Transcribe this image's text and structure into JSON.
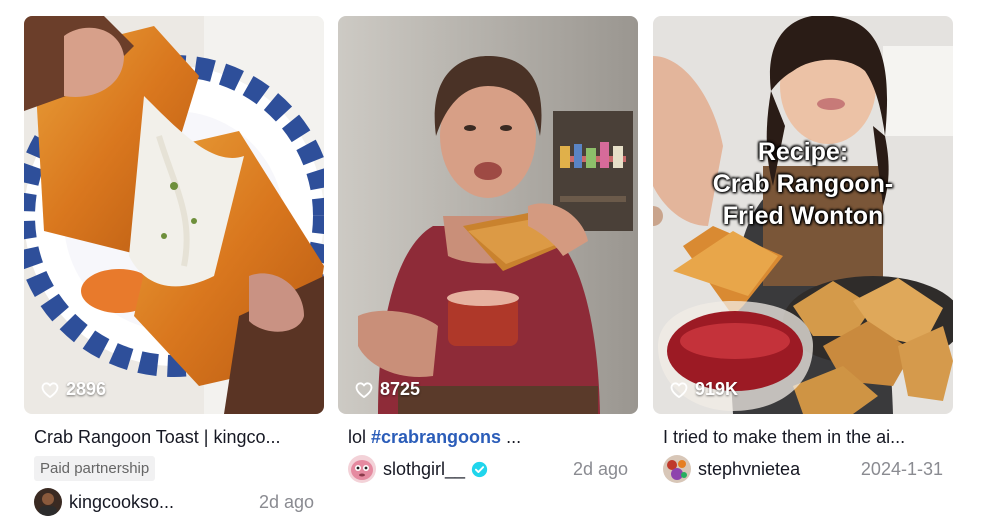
{
  "cards": [
    {
      "likes": "2896",
      "description": "Crab Rangoon Toast | kingco...",
      "badge": "Paid partnership",
      "username": "kingcookso...",
      "date": "2d ago",
      "verified": false
    },
    {
      "likes": "8725",
      "description_prefix": "lol ",
      "hashtag": "#crabrangoons",
      "description_suffix": " ...",
      "username": "slothgirl__",
      "date": "2d ago",
      "verified": true
    },
    {
      "likes": "919K",
      "overlay_text": [
        "Recipe:",
        "Crab Rangoon-",
        "Fried Wonton"
      ],
      "description": "I tried to make them in the ai...",
      "username": "stephvnietea",
      "date": "2024-1-31",
      "verified": false
    }
  ],
  "icons": {
    "like": "heart-outline-icon",
    "verified": "verified-badge-icon"
  },
  "colors": {
    "hashtag": "#2b5db9",
    "verified": "#20d5ec",
    "muted": "#8a8b91"
  }
}
